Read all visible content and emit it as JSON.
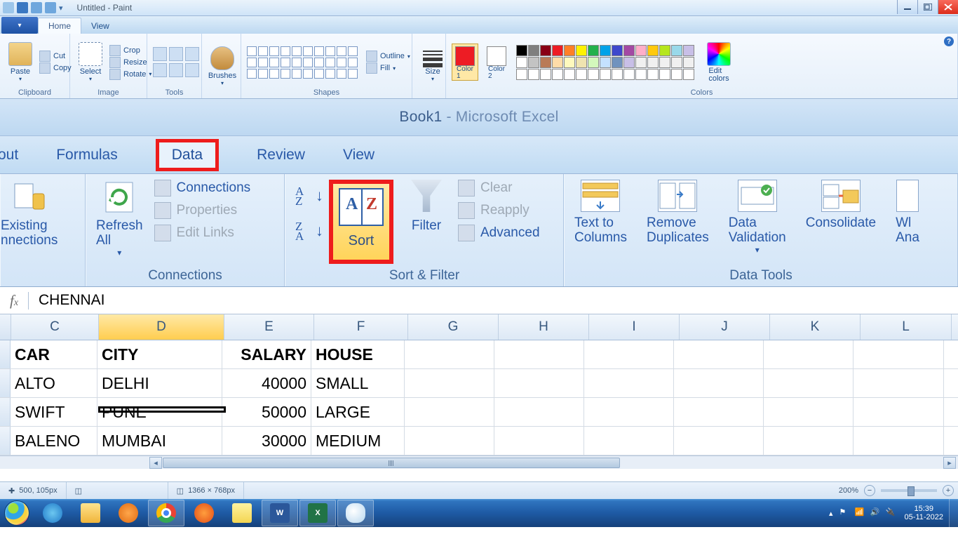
{
  "paint": {
    "title": "Untitled - Paint",
    "tabs": {
      "file": "",
      "home": "Home",
      "view": "View"
    },
    "clipboard": {
      "label": "Clipboard",
      "paste": "Paste",
      "cut": "Cut",
      "copy": "Copy"
    },
    "image": {
      "label": "Image",
      "select": "Select",
      "crop": "Crop",
      "resize": "Resize",
      "rotate": "Rotate"
    },
    "tools": {
      "label": "Tools"
    },
    "brushes": {
      "label": "Brushes",
      "btn": "Brushes"
    },
    "shapes": {
      "label": "Shapes",
      "outline": "Outline",
      "fill": "Fill"
    },
    "size": {
      "label": "Size",
      "btn": "Size"
    },
    "colors": {
      "label": "Colors",
      "c1": "Color\n1",
      "c2": "Color\n2",
      "edit": "Edit\ncolors"
    }
  },
  "excel": {
    "title_left": "Book1",
    "title_right": "Microsoft Excel",
    "tabs": {
      "layout": "out",
      "formulas": "Formulas",
      "data": "Data",
      "review": "Review",
      "view": "View"
    },
    "conn_grp": {
      "existing": "Existing\nnnections",
      "refresh": "Refresh\nAll",
      "connections": "Connections",
      "properties": "Properties",
      "editlinks": "Edit Links",
      "label": "Connections"
    },
    "sort_grp": {
      "sort": "Sort",
      "filter": "Filter",
      "clear": "Clear",
      "reapply": "Reapply",
      "advanced": "Advanced",
      "label": "Sort & Filter"
    },
    "dt_grp": {
      "t2c": "Text to\nColumns",
      "rdup": "Remove\nDuplicates",
      "dval": "Data\nValidation",
      "cons": "Consolidate",
      "wia": "Wl\nAna",
      "label": "Data Tools"
    },
    "formula_val": "CHENNAI",
    "cols": [
      "C",
      "D",
      "E",
      "F",
      "G",
      "H",
      "I",
      "J",
      "K",
      "L"
    ],
    "rows": [
      {
        "c": "CAR",
        "d": "CITY",
        "e": "SALARY",
        "f": "HOUSE",
        "hdr": true
      },
      {
        "c": "ALTO",
        "d": "DELHI",
        "e": "40000",
        "f": "SMALL"
      },
      {
        "c": "SWIFT",
        "d": "PUNE",
        "e": "50000",
        "f": "LARGE"
      },
      {
        "c": "BALENO",
        "d": "MUMBAI",
        "e": "30000",
        "f": "MEDIUM"
      }
    ]
  },
  "status": {
    "coords": "500, 105px",
    "canvas": "1366 × 768px",
    "zoom": "200%"
  },
  "tray": {
    "time": "15:39",
    "date": "05-11-2022"
  },
  "chart_data": {
    "type": "table",
    "columns": [
      "CAR",
      "CITY",
      "SALARY",
      "HOUSE"
    ],
    "rows": [
      [
        "ALTO",
        "DELHI",
        40000,
        "SMALL"
      ],
      [
        "SWIFT",
        "PUNE",
        50000,
        "LARGE"
      ],
      [
        "BALENO",
        "MUMBAI",
        30000,
        "MEDIUM"
      ]
    ]
  }
}
